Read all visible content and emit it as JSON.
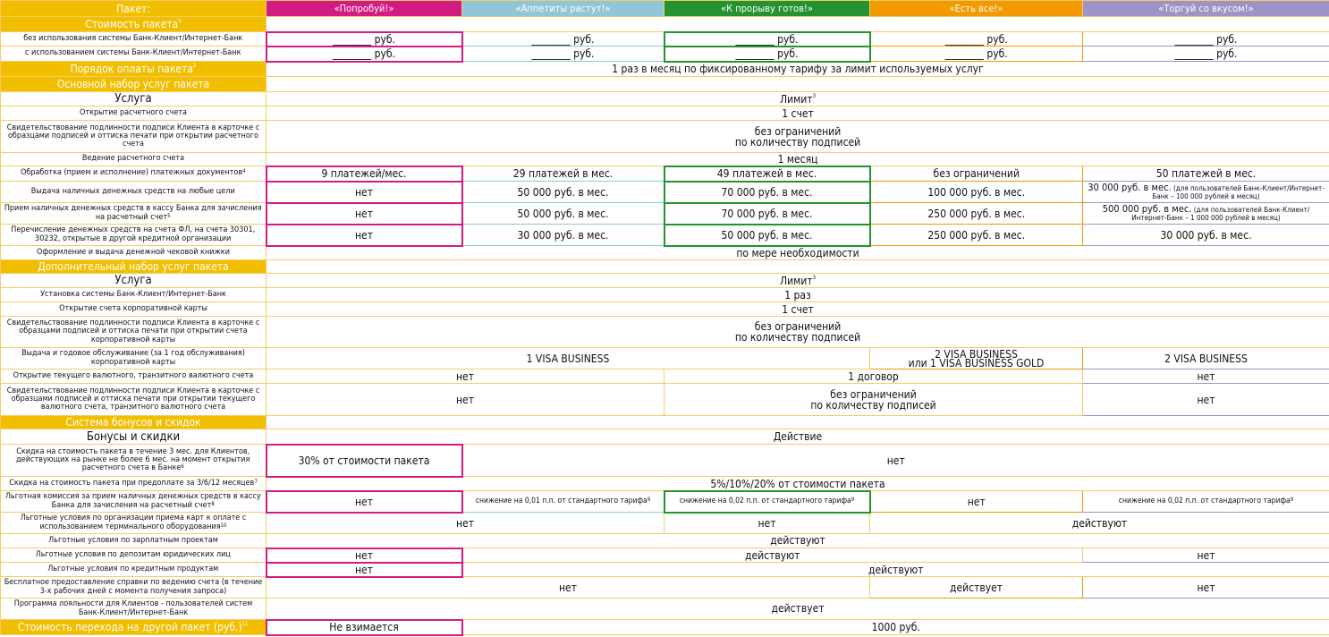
{
  "header": {
    "label": "Пакет:",
    "packages": [
      "«Попробуй!»",
      "«Аппетиты растут!»",
      "«К прорыву готов!»",
      "«Есть все!»",
      "«Торгуй со вкусом!»"
    ]
  },
  "sections": {
    "cost": "Стоимость пакета",
    "cost_sup": "1",
    "payment": "Порядок оплаты пакета",
    "payment_sup": "2",
    "basic": "Основной набор услуг пакета",
    "extra": "Дополнительный набор услуг пакета",
    "bonus": "Система бонусов и скидок",
    "switch": "Стоимость перехода на другой пакет (руб.)",
    "switch_sup": "11"
  },
  "cost": {
    "row1": "без использования системы Банк-Клиент/Интернет-Банк",
    "row2": "с использованием системы Банк-Клиент/Интернет-Банк",
    "price": "________ руб."
  },
  "payment_text": "1 раз в месяц по фиксированному тарифу за лимит используемых услуг",
  "basic": {
    "service": "Услуга",
    "limit": "Лимит",
    "limit_sup": "3",
    "r1": {
      "label": "Открытие расчетного счета",
      "val": "1 счет"
    },
    "r2": {
      "label": "Свидетельствование подлинности подписи Клиента в карточке с образцами подписей и оттиска печати при открытии расчетного счета",
      "val1": "без ограничений",
      "val2": "по количеству подписей"
    },
    "r3": {
      "label": "Ведение расчетного счета",
      "val": "1 месяц"
    },
    "r4": {
      "label": "Обработка (прием и исполнение) платежных документов",
      "sup": "4",
      "v": [
        "9 платежей/мес.",
        "29 платежей в мес.",
        "49 платежей в мес.",
        "без ограничений",
        "50 платежей в мес."
      ]
    },
    "r5": {
      "label": "Выдача наличных денежных средств на любые цели",
      "v": [
        "нет",
        "50 000 руб. в мес.",
        "70 000 руб. в мес.",
        "100 000 руб. в мес."
      ],
      "v5a": "30 000 руб. в мес.",
      "v5b": "(для пользователей Банк-Клиент/Интернет-Банк – 100 000 рублей в месяц)"
    },
    "r6": {
      "label": "Прием наличных денежных средств в кассу Банка для зачисления на расчетный счет",
      "sup": "5",
      "v": [
        "нет",
        "50 000 руб. в мес.",
        "70 000 руб. в мес.",
        "250 000 руб. в мес."
      ],
      "v5a": "500 000 руб. в мес.",
      "v5b": "(для пользователей Банк-Клиент/Интернет-Банк – 1 000 000 рублей в месяц)"
    },
    "r7": {
      "label": "Перечисление денежных средств на счета ФЛ, на счета 30301, 30232, открытые в другой кредитной организации",
      "v": [
        "нет",
        "30 000 руб. в мес.",
        "50 000 руб. в мес.",
        "250 000 руб. в мес.",
        "30 000 руб. в мес."
      ]
    },
    "r8": {
      "label": "Оформление и выдача денежной чековой книжки",
      "val": "по мере необходимости"
    }
  },
  "extra": {
    "service": "Услуга",
    "limit": "Лимит",
    "limit_sup": "3",
    "r1": {
      "label": "Установка системы Банк-Клиент/Интернет-Банк",
      "val": "1 раз"
    },
    "r2": {
      "label": "Открытие счета корпоративной карты",
      "val": "1 счет"
    },
    "r3": {
      "label": "Свидетельствование подлинности подписи Клиента в карточке с образцами подписей и оттиска печати при открытии счета корпоративной карты",
      "val1": "без ограничений",
      "val2": "по количеству подписей"
    },
    "r4": {
      "label": "Выдача и годовое обслуживание (за 1 год обслуживания) корпоративной карты",
      "a": "1 VISA BUSINESS",
      "b1": "2 VISA BUSINESS",
      "b2": "или 1 VISA BUSINESS GOLD",
      "c": "2 VISA BUSINESS"
    },
    "r5": {
      "label": "Открытие текущего валютного, транзитного валютного счета",
      "a": "нет",
      "b": "1 договор",
      "c": "нет"
    },
    "r6": {
      "label": "Свидетельствование подлинности подписи Клиента в карточке с образцами подписей и оттиска печати при открытии текущего валютного счета, транзитного валютного счета",
      "a": "нет",
      "b1": "без ограничений",
      "b2": "по количеству подписей",
      "c": "нет"
    }
  },
  "bonus": {
    "head_a": "Бонусы и скидки",
    "head_b": "Действие",
    "r1": {
      "label": "Скидка на стоимость пакета в течение 3 мес. для Клиентов, действующих на рынке не более 6 мес. на момент открытия расчетного счета в Банке",
      "sup": "6",
      "a": "30% от стоимости пакета",
      "b": "нет"
    },
    "r2": {
      "label": "Скидка на стоимость пакета при предоплате за 3/6/12 месяцев",
      "sup": "7",
      "val": "5%/10%/20% от стоимости пакета"
    },
    "r3": {
      "label": "Льготная комиссия за прием наличных денежных средств в кассу Банка для зачисления на расчетный счет",
      "sup": "8",
      "v1": "нет",
      "v2": "снижение на 0,01 п.п. от стандартного тарифа",
      "v3": "снижение на 0,02 п.п. от стандартного тарифа",
      "v4": "нет",
      "v5": "снижение на 0,02 п.п. от стандартного тарифа",
      "vsup": "9"
    },
    "r4": {
      "label": "Льготные условия по организации приема карт к оплате с использованием терминального оборудования",
      "sup": "10",
      "a": "нет",
      "b": "нет",
      "c": "действуют"
    },
    "r5": {
      "label": "Льготные условия по зарплатным проектам",
      "val": "действуют"
    },
    "r6": {
      "label": "Льготные условия по депозитам юридических лиц",
      "a": "нет",
      "b": "действуют",
      "c": "нет"
    },
    "r7": {
      "label": "Льготные условия по кредитным продуктам",
      "a": "нет",
      "b": "действуют"
    },
    "r8": {
      "label": "Бесплатное предоставление справки по ведению счета (в течение 3-х рабочих дней с момента получения запроса)",
      "a": "нет",
      "b": "действует",
      "c": "нет"
    },
    "r9": {
      "label": "Программа лояльности для Клиентов - пользователей систем Банк-Клиент/Интернет-Банк",
      "val": "действует"
    }
  },
  "switch": {
    "a": "Не взимается",
    "b": "1000 руб."
  }
}
